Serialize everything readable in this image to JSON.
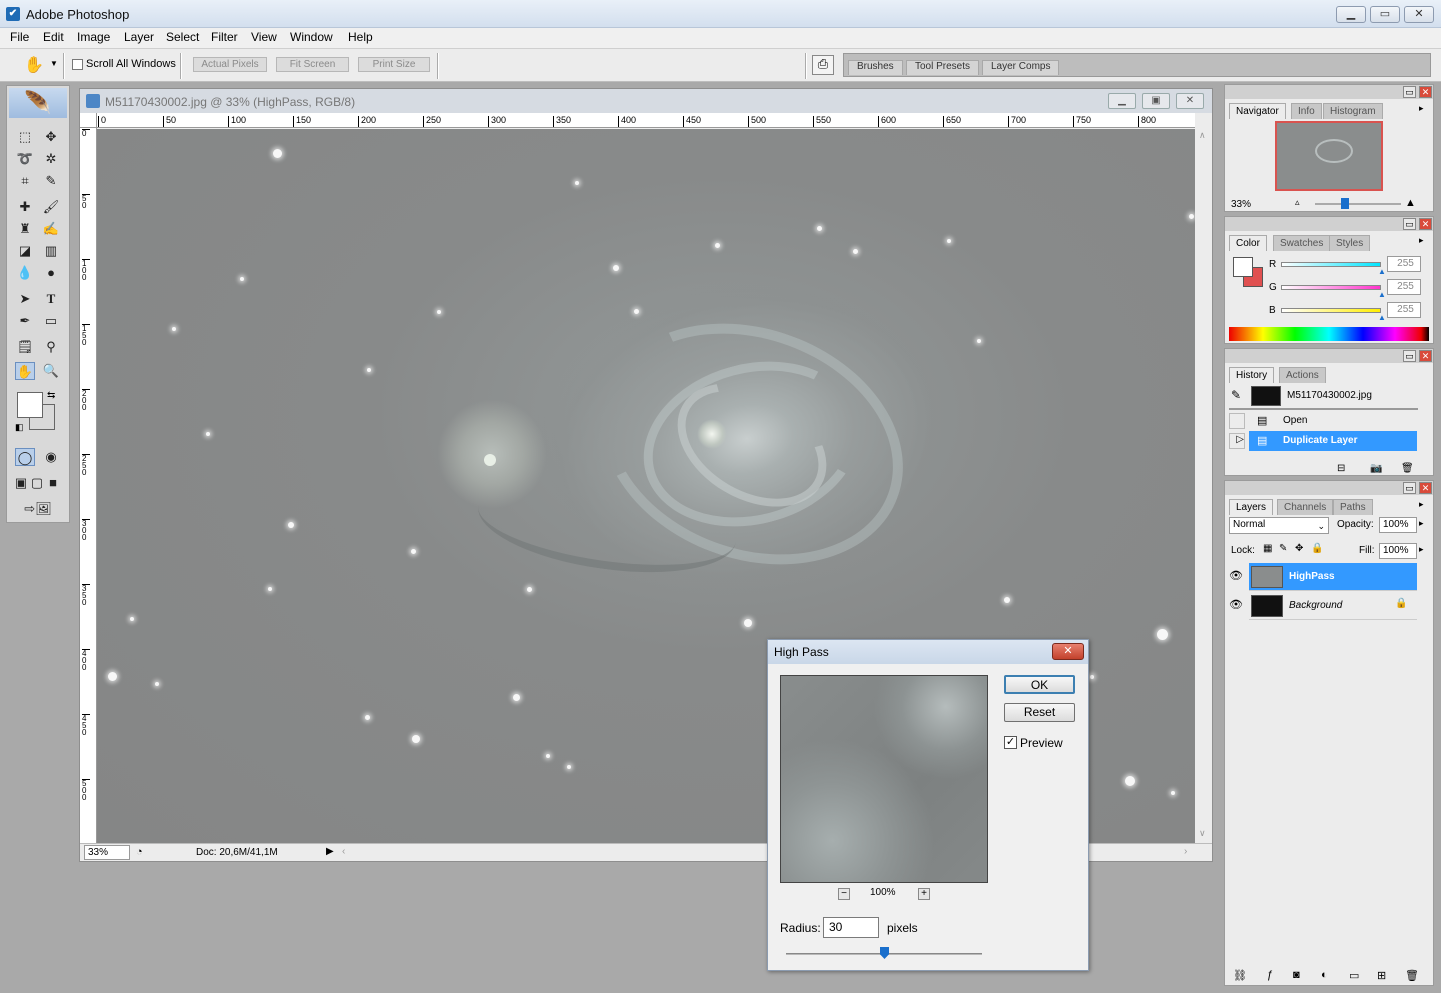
{
  "app": {
    "title": "Adobe Photoshop"
  },
  "menu": [
    "File",
    "Edit",
    "Image",
    "Layer",
    "Select",
    "Filter",
    "View",
    "Window",
    "Help"
  ],
  "options": {
    "scroll_all": "Scroll All Windows",
    "actual_pixels": "Actual Pixels",
    "fit_screen": "Fit Screen",
    "print_size": "Print Size",
    "well_tabs": [
      "Brushes",
      "Tool Presets",
      "Layer Comps"
    ]
  },
  "document": {
    "title": "M51170430002.jpg @ 33% (HighPass, RGB/8)",
    "zoom": "33%",
    "doc_size": "Doc: 20,6M/41,1M",
    "ruler_h": [
      "0",
      "50",
      "100",
      "150",
      "200",
      "250",
      "300",
      "350",
      "400",
      "450",
      "500",
      "550",
      "600",
      "650",
      "700",
      "750",
      "800"
    ],
    "ruler_v": [
      "0",
      "50",
      "100",
      "150",
      "200",
      "250",
      "300",
      "350",
      "400",
      "450",
      "500"
    ]
  },
  "navigator": {
    "tabs": [
      "Navigator",
      "Info",
      "Histogram"
    ],
    "zoom": "33%"
  },
  "color": {
    "tabs": [
      "Color",
      "Swatches",
      "Styles"
    ],
    "channels": [
      {
        "label": "R",
        "value": "255",
        "color": "#00e5ff"
      },
      {
        "label": "G",
        "value": "255",
        "color": "#ff33cc"
      },
      {
        "label": "B",
        "value": "255",
        "color": "#ffee00"
      }
    ],
    "bg_color": "#e05050"
  },
  "history": {
    "tabs": [
      "History",
      "Actions"
    ],
    "snapshot": "M51170430002.jpg",
    "items": [
      "Open",
      "Duplicate Layer"
    ],
    "selected": "Duplicate Layer"
  },
  "layers": {
    "tabs": [
      "Layers",
      "Channels",
      "Paths"
    ],
    "blend": "Normal",
    "opacity_label": "Opacity:",
    "opacity": "100%",
    "lock_label": "Lock:",
    "fill_label": "Fill:",
    "fill": "100%",
    "items": [
      {
        "name": "HighPass",
        "selected": true
      },
      {
        "name": "Background",
        "selected": false
      }
    ]
  },
  "dialog": {
    "title": "High Pass",
    "ok": "OK",
    "reset": "Reset",
    "preview_label": "Preview",
    "preview_checked": true,
    "zoom": "100%",
    "zoom_out": "−",
    "zoom_in": "+",
    "radius_label": "Radius:",
    "radius_value": "30",
    "unit": "pixels",
    "radius_slider": 0.5
  }
}
